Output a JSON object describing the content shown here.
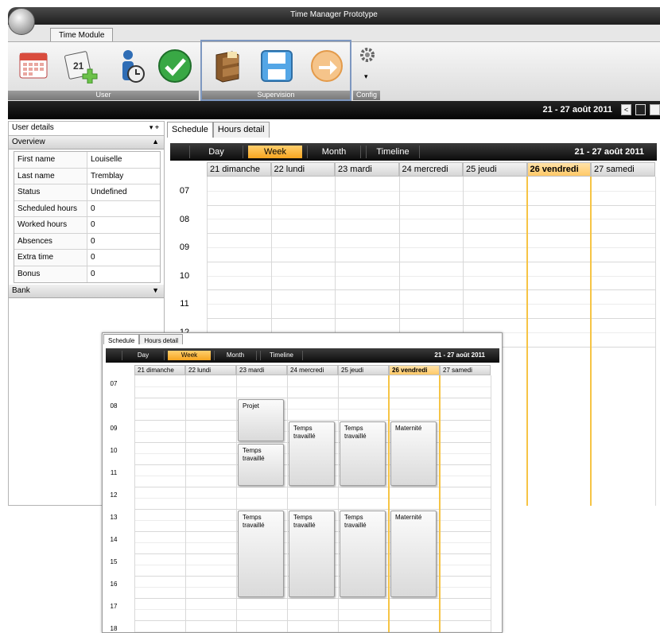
{
  "app": {
    "title": "Time Manager Prototype"
  },
  "ribbon": {
    "tab": "Time Module",
    "groups": [
      {
        "label": "User",
        "items": [
          "calendar-icon",
          "calendar-add-icon",
          "user-clock-icon",
          "check-icon"
        ]
      },
      {
        "label": "Supervision",
        "items": [
          "cabinet-icon",
          "save-icon",
          "forward-icon"
        ]
      },
      {
        "label": "Config",
        "items": [
          "settings-icon"
        ]
      }
    ]
  },
  "header": {
    "range": "21 - 27 août 2011",
    "prev": "<"
  },
  "left_panel": {
    "title": "User details",
    "pin": "▾  ⌖",
    "overview": {
      "title": "Overview",
      "toggle": "▲"
    },
    "fields": [
      {
        "key": "First name",
        "value": "Louiselle"
      },
      {
        "key": "Last name",
        "value": "Tremblay"
      },
      {
        "key": "Status",
        "value": "Undefined"
      },
      {
        "key": "Scheduled hours",
        "value": "0"
      },
      {
        "key": "Worked hours",
        "value": "0"
      },
      {
        "key": "Absences",
        "value": "0"
      },
      {
        "key": "Extra time",
        "value": "0"
      },
      {
        "key": "Bonus",
        "value": "0"
      }
    ],
    "bank": {
      "title": "Bank",
      "toggle": "▼"
    }
  },
  "schedule": {
    "tabs": [
      "Schedule",
      "Hours detail"
    ],
    "views": [
      "Day",
      "Week",
      "Month",
      "Timeline"
    ],
    "active_view": "Week",
    "range": "21 - 27 août 2011",
    "days": [
      "21 dimanche",
      "22 lundi",
      "23 mardi",
      "24 mercredi",
      "25 jeudi",
      "26 vendredi",
      "27 samedi"
    ],
    "highlight_day": "26 vendredi",
    "hours_main": [
      "07",
      "08",
      "09",
      "10",
      "11",
      "12"
    ],
    "hours_overlay": [
      "07",
      "08",
      "09",
      "10",
      "11",
      "12",
      "13",
      "14",
      "15",
      "16",
      "17",
      "18"
    ]
  },
  "overlay": {
    "tabs": [
      "Schedule",
      "Hours detail"
    ],
    "appointments": [
      {
        "day": 2,
        "start": 8,
        "end": 10,
        "label": "Projet"
      },
      {
        "day": 2,
        "start": 10,
        "end": 12,
        "label": "Temps travaillé"
      },
      {
        "day": 3,
        "start": 9,
        "end": 12,
        "label": "Temps travaillé"
      },
      {
        "day": 4,
        "start": 9,
        "end": 12,
        "label": "Temps travaillé"
      },
      {
        "day": 5,
        "start": 9,
        "end": 12,
        "label": "Maternité"
      },
      {
        "day": 2,
        "start": 13,
        "end": 17,
        "label": "Temps travaillé"
      },
      {
        "day": 3,
        "start": 13,
        "end": 17,
        "label": "Temps travaillé"
      },
      {
        "day": 4,
        "start": 13,
        "end": 17,
        "label": "Temps travaillé"
      },
      {
        "day": 5,
        "start": 13,
        "end": 17,
        "label": "Maternité"
      }
    ]
  },
  "colors": {
    "highlight": "#f6c445",
    "active_view": "#f7a520",
    "supervision_box": "#7d97c0"
  }
}
